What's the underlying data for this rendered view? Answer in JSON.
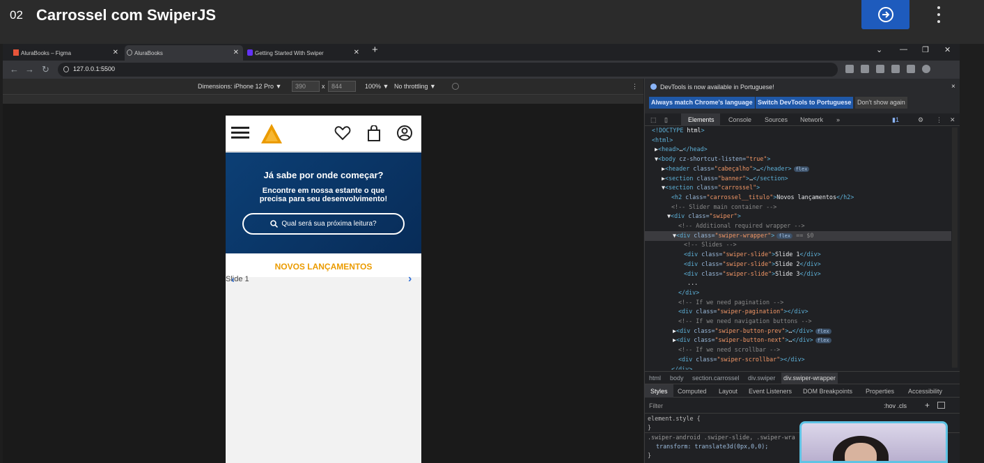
{
  "lesson": {
    "number": "02",
    "title": "Carrossel com SwiperJS"
  },
  "browser": {
    "tabs": [
      {
        "label": "AluraBooks – Figma"
      },
      {
        "label": "AluraBooks"
      },
      {
        "label": "Getting Started With Swiper"
      }
    ],
    "url": "127.0.0.1:5500"
  },
  "device_toolbar": {
    "dimensions": "Dimensions: iPhone 12 Pro ▼",
    "width": "390",
    "times": "x",
    "height": "844",
    "zoom": "100% ▼",
    "throttle": "No throttling ▼"
  },
  "phone": {
    "banner_title": "Já sabe por onde começar?",
    "banner_sub1": "Encontre em nossa estante o que",
    "banner_sub2": "precisa para seu desenvolvimento!",
    "search_placeholder": "Qual será sua próxima leitura?",
    "section_title": "NOVOS LANÇAMENTOS",
    "slide_text": "Slide 1"
  },
  "devtools": {
    "notice": "DevTools is now available in Portuguese!",
    "btn_match": "Always match Chrome's language",
    "btn_switch": "Switch DevTools to Portuguese",
    "btn_dismiss": "Don't show again",
    "tabs": [
      "Elements",
      "Console",
      "Sources",
      "Network"
    ],
    "code_lines": [
      "<!DOCTYPE html>",
      "<html>",
      "▶<head>…</head>",
      "▼<body cz-shortcut-listen=\"true\">",
      "▶<header class=\"cabeçalho\">…</header>",
      "▶<section class=\"banner\">…</section>",
      "▼<section class=\"carrossel\">",
      "<h2 class=\"carrossel__titulo\">Novos lançamentos</h2>",
      "<!-- Slider main container -->",
      "▼<div class=\"swiper\">",
      "<!-- Additional required wrapper -->",
      "▼<div class=\"swiper-wrapper\">",
      "<!-- Slides -->",
      "<div class=\"swiper-slide\">Slide 1</div>",
      "<div class=\"swiper-slide\">Slide 2</div>",
      "<div class=\"swiper-slide\">Slide 3</div>",
      "\" ... \"",
      "</div>",
      "<!-- If we need pagination -->",
      "<div class=\"swiper-pagination\"></div>",
      "<!-- If we need navigation buttons -->",
      "▶<div class=\"swiper-button-prev\">…</div>",
      "▶<div class=\"swiper-button-next\">…</div>",
      "<!-- If we need scrollbar -->",
      "<div class=\"swiper-scrollbar\"></div>",
      "</div>"
    ],
    "flex_badge": "flex",
    "selected_suffix": "== $0",
    "breadcrumbs": [
      "html",
      "body",
      "section.carrossel",
      "div.swiper",
      "div.swiper-wrapper"
    ],
    "style_tabs": [
      "Styles",
      "Computed",
      "Layout",
      "Event Listeners",
      "DOM Breakpoints",
      "Properties",
      "Accessibility"
    ],
    "filter_placeholder": "Filter",
    "filter_tools": ":hov .cls",
    "styles_lines": [
      "element.style {",
      "}",
      ".swiper-android .swiper-slide, .swiper-wra",
      "transform: translate3d(0px,0,0);",
      "}"
    ]
  }
}
